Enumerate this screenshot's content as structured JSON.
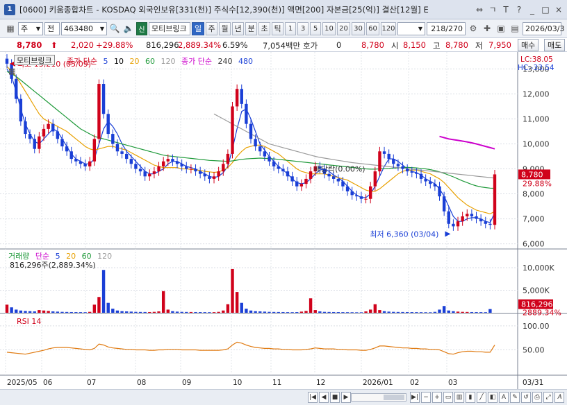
{
  "window": {
    "number": "1",
    "title": "[0600] 키움종합차트 - KOSDAQ 외국인보유[331(천)] 주식수[12,390(천)] 액면[200] 자본금[25(억)] 결산[12월] E",
    "controls": [
      "⇔",
      "ㄱ",
      "T",
      "?",
      "_",
      "□",
      "×"
    ]
  },
  "toolbar": {
    "market": "주",
    "type": "전",
    "code": "463480",
    "stock_name": "모티브링크",
    "period_tabs": [
      "일",
      "주",
      "월",
      "년",
      "분",
      "초",
      "틱"
    ],
    "active_period": "일",
    "intervals": [
      "1",
      "3",
      "5",
      "10",
      "20",
      "30",
      "60",
      "120"
    ],
    "count": "218",
    "count_total": "/270",
    "date": "2026/03/3",
    "sin_label": "신"
  },
  "price": {
    "current": "8,780",
    "change": "2,020",
    "change_pct": "+29.88%",
    "volume": "816,296",
    "volume_pct": "2,889.34%",
    "turnover": "6.59%",
    "amount": "7,054백만",
    "hoga_label": "호가",
    "hoga_value": "0",
    "hoga_price": "8,780",
    "open_label": "시",
    "open": "8,150",
    "high_label": "고",
    "high": "8,780",
    "low_label": "저",
    "low": "7,950",
    "buy_label": "매수",
    "sell_label": "매도"
  },
  "main_legend": {
    "badge": "모티브링크",
    "ma_label": "종가 단순",
    "ma_periods": [
      "5",
      "10",
      "20",
      "60",
      "120"
    ],
    "ma_colors": [
      "#1a3fd6",
      "#000000",
      "#e8a000",
      "#1f9a3a",
      "#9a9a9a"
    ],
    "ma2_label": "종가 단순",
    "ma2_periods": [
      "240",
      "480"
    ],
    "ma2_colors": [
      "#333333",
      "#cc00cc"
    ],
    "lc": "LC:38.05",
    "hc": "HC:-33.54"
  },
  "annotations": {
    "high": "최고 13,210 (05/09)",
    "low": "최저 6,360 (03/04)",
    "dividend": "배당락(0.00%)"
  },
  "volume_legend": {
    "label": "거래량",
    "ma_label": "단순",
    "periods": [
      "5",
      "20",
      "60",
      "120"
    ],
    "colors": [
      "#1a3fd6",
      "#e8a000",
      "#1f9a3a",
      "#9a9a9a"
    ],
    "value": "816,296주(2,889.34%)",
    "axis_marker": "816,296",
    "axis_marker2": "2889.34%"
  },
  "rsi_legend": {
    "label": "RSI 14"
  },
  "colors": {
    "up": "#d0021b",
    "down": "#1a3fd6",
    "rsi": "#e07a10"
  },
  "chart_data": [
    {
      "type": "candlestick",
      "title": "모티브링크",
      "x_labels": [
        "2025/05",
        "06",
        "07",
        "08",
        "09",
        "10",
        "11",
        "12",
        "2026/01",
        "02",
        "03",
        "03/31"
      ],
      "y_ticks": [
        6000,
        7000,
        8000,
        9000,
        10000,
        11000,
        12000,
        13000
      ],
      "ylim": [
        5850,
        13400
      ],
      "current_price": 8780,
      "current_pct": "29.88%",
      "series": [
        {
          "name": "close",
          "values": [
            13210,
            12600,
            11800,
            10900,
            10400,
            10200,
            9800,
            10300,
            10600,
            10800,
            10500,
            10200,
            9900,
            9700,
            9400,
            9300,
            9200,
            9100,
            9300,
            10200,
            12400,
            11200,
            10400,
            10000,
            9700,
            9600,
            9400,
            9200,
            9000,
            8900,
            8700,
            8800,
            8900,
            9100,
            9300,
            9400,
            9300,
            9200,
            9100,
            9000,
            9000,
            8900,
            8800,
            8700,
            8600,
            8700,
            8900,
            9200,
            9600,
            11500,
            12200,
            11600,
            10800,
            10200,
            9900,
            9700,
            9500,
            9300,
            9100,
            9000,
            8900,
            8700,
            8500,
            8300,
            8400,
            8600,
            8900,
            9100,
            9000,
            8800,
            8700,
            8600,
            8500,
            8300,
            8100,
            7950,
            7900,
            7800,
            7800,
            8300,
            8900,
            9700,
            9600,
            9400,
            9200,
            9100,
            9000,
            8900,
            8850,
            8800,
            8600,
            8500,
            8400,
            8300,
            7900,
            7300,
            6800,
            6700,
            6900,
            7100,
            7200,
            7100,
            7000,
            6900,
            6800,
            6760,
            8780
          ]
        },
        {
          "name": "ma5",
          "values": [
            13000,
            12700,
            12100,
            11400,
            10800,
            10400,
            10100,
            10000,
            10200,
            10400,
            10600,
            10500,
            10200,
            9900,
            9600,
            9400,
            9300,
            9200,
            9200,
            9400,
            10000,
            10600,
            10900,
            10700,
            10400,
            10000,
            9700,
            9500,
            9300,
            9100,
            8900,
            8800,
            8800,
            8900,
            9000,
            9200,
            9300,
            9300,
            9200,
            9100,
            9050,
            9000,
            8900,
            8800,
            8700,
            8650,
            8700,
            8850,
            9100,
            9800,
            10600,
            11300,
            11400,
            11000,
            10500,
            10000,
            9750,
            9500,
            9300,
            9100,
            8950,
            8800,
            8600,
            8450,
            8400,
            8450,
            8600,
            8800,
            8950,
            9000,
            8900,
            8750,
            8650,
            8500,
            8300,
            8100,
            7950,
            7850,
            7850,
            8000,
            8300,
            8700,
            9100,
            9400,
            9400,
            9300,
            9150,
            9000,
            8900,
            8850,
            8750,
            8600,
            8500,
            8400,
            8200,
            7900,
            7500,
            7100,
            6900,
            6900,
            7000,
            7050,
            7050,
            7000,
            6900,
            6850,
            7250
          ]
        },
        {
          "name": "ma20",
          "values": [
            13100,
            12900,
            12700,
            12400,
            12100,
            11800,
            11500,
            11200,
            11000,
            10900,
            10800,
            10700,
            10600,
            10500,
            10350,
            10200,
            10050,
            9900,
            9800,
            9750,
            9800,
            9850,
            9900,
            9900,
            9850,
            9800,
            9750,
            9650,
            9550,
            9450,
            9350,
            9250,
            9150,
            9100,
            9050,
            9050,
            9050,
            9050,
            9000,
            9000,
            8980,
            8960,
            8940,
            8900,
            8880,
            8860,
            8880,
            8950,
            9050,
            9250,
            9500,
            9700,
            9850,
            9900,
            9950,
            9950,
            9900,
            9800,
            9700,
            9600,
            9450,
            9300,
            9150,
            9000,
            8900,
            8850,
            8800,
            8800,
            8800,
            8800,
            8750,
            8700,
            8650,
            8600,
            8550,
            8450,
            8350,
            8250,
            8150,
            8100,
            8100,
            8200,
            8350,
            8500,
            8650,
            8800,
            8900,
            8950,
            8950,
            8950,
            8900,
            8850,
            8800,
            8700,
            8600,
            8450,
            8250,
            8050,
            7850,
            7700,
            7550,
            7450,
            7350,
            7300,
            7250,
            7200,
            7300
          ]
        },
        {
          "name": "ma60",
          "values": [
            12900,
            12800,
            12700,
            12550,
            12400,
            12250,
            12100,
            11950,
            11800,
            11650,
            11500,
            11350,
            11200,
            11050,
            10900,
            10750,
            10600,
            10500,
            10400,
            10300,
            10250,
            10200,
            10150,
            10100,
            10050,
            10000,
            9950,
            9900,
            9850,
            9800,
            9750,
            9700,
            9650,
            9600,
            9550,
            9520,
            9500,
            9480,
            9460,
            9440,
            9420,
            9400,
            9380,
            9360,
            9340,
            9330,
            9320,
            9310,
            9300,
            9320,
            9350,
            9380,
            9400,
            9410,
            9420,
            9430,
            9420,
            9410,
            9400,
            9380,
            9360,
            9340,
            9320,
            9300,
            9280,
            9260,
            9240,
            9220,
            9200,
            9180,
            9160,
            9140,
            9120,
            9100,
            9080,
            9060,
            9040,
            9020,
            9000,
            8990,
            8990,
            9000,
            9010,
            9020,
            9030,
            9040,
            9050,
            9060,
            9050,
            9040,
            9020,
            9000,
            8970,
            8930,
            8880,
            8820,
            8750,
            8680,
            8600,
            8520,
            8450,
            8380,
            8320,
            8280,
            8250,
            8230,
            8220
          ]
        },
        {
          "name": "ma120",
          "values": [
            null,
            null,
            null,
            null,
            null,
            null,
            null,
            null,
            null,
            null,
            null,
            null,
            null,
            null,
            null,
            null,
            null,
            null,
            null,
            null,
            null,
            null,
            null,
            null,
            null,
            null,
            null,
            null,
            null,
            null,
            null,
            null,
            null,
            null,
            null,
            null,
            null,
            null,
            null,
            null,
            null,
            null,
            null,
            null,
            null,
            11200,
            11100,
            11000,
            10900,
            10800,
            10700,
            10600,
            10500,
            10400,
            10300,
            10200,
            10100,
            10000,
            9950,
            9900,
            9850,
            9800,
            9750,
            9700,
            9650,
            9600,
            9550,
            9500,
            9460,
            9430,
            9400,
            9370,
            9340,
            9310,
            9280,
            9250,
            9230,
            9210,
            9190,
            9170,
            9150,
            9130,
            9110,
            9090,
            9070,
            9050,
            9030,
            9010,
            8990,
            8970,
            8950,
            8930,
            8910,
            8890,
            8870,
            8850,
            8830,
            8810,
            8790,
            8770,
            8750,
            8730,
            8710,
            8690,
            8670,
            8650,
            8630
          ]
        },
        {
          "name": "ma480",
          "values": [
            null,
            null,
            null,
            null,
            null,
            null,
            null,
            null,
            null,
            null,
            null,
            null,
            null,
            null,
            null,
            null,
            null,
            null,
            null,
            null,
            null,
            null,
            null,
            null,
            null,
            null,
            null,
            null,
            null,
            null,
            null,
            null,
            null,
            null,
            null,
            null,
            null,
            null,
            null,
            null,
            null,
            null,
            null,
            null,
            null,
            null,
            null,
            null,
            null,
            null,
            null,
            null,
            null,
            null,
            null,
            null,
            null,
            null,
            null,
            null,
            null,
            null,
            null,
            null,
            null,
            null,
            null,
            null,
            null,
            null,
            null,
            null,
            null,
            null,
            null,
            null,
            null,
            null,
            null,
            null,
            null,
            null,
            null,
            null,
            null,
            null,
            null,
            null,
            null,
            null,
            null,
            null,
            null,
            null,
            10300,
            10250,
            10200,
            10170,
            10140,
            10110,
            10080,
            10040,
            10000,
            9950,
            9900,
            9850,
            9800
          ]
        }
      ]
    },
    {
      "type": "bar",
      "title": "거래량",
      "y_ticks": [
        "5,000K",
        "10,000K"
      ],
      "ylim": [
        0,
        12000
      ],
      "series": [
        {
          "name": "volume",
          "values": [
            1800,
            1200,
            700,
            500,
            400,
            350,
            300,
            600,
            500,
            400,
            300,
            250,
            200,
            180,
            160,
            150,
            140,
            130,
            200,
            1800,
            3500,
            9500,
            2200,
            900,
            500,
            350,
            300,
            250,
            200,
            180,
            170,
            160,
            200,
            300,
            4800,
            700,
            350,
            250,
            200,
            180,
            170,
            160,
            150,
            140,
            130,
            140,
            200,
            500,
            1900,
            9700,
            4600,
            2200,
            900,
            500,
            350,
            300,
            250,
            200,
            180,
            170,
            160,
            140,
            130,
            150,
            250,
            400,
            3200,
            600,
            300,
            200,
            180,
            160,
            150,
            140,
            130,
            120,
            110,
            110,
            300,
            700,
            1900,
            600,
            350,
            250,
            200,
            180,
            170,
            160,
            150,
            140,
            130,
            120,
            110,
            200,
            700,
            1500,
            500,
            350,
            250,
            200,
            180,
            160,
            150,
            140,
            130,
            816
          ]
        }
      ]
    },
    {
      "type": "line",
      "title": "RSI 14",
      "y_ticks": [
        "50.00",
        "100.00"
      ],
      "ylim": [
        0,
        110
      ],
      "series": [
        {
          "name": "RSI 14",
          "values": [
            45,
            44,
            43,
            42,
            41,
            43,
            45,
            47,
            49,
            52,
            54,
            55,
            55,
            55,
            54,
            53,
            52,
            51,
            50,
            53,
            62,
            60,
            56,
            54,
            53,
            52,
            51,
            51,
            50,
            50,
            50,
            49,
            49,
            50,
            50,
            51,
            51,
            51,
            50,
            50,
            50,
            50,
            49,
            49,
            49,
            49,
            49,
            50,
            52,
            60,
            66,
            64,
            60,
            57,
            55,
            54,
            53,
            53,
            52,
            52,
            51,
            51,
            50,
            50,
            50,
            51,
            52,
            54,
            53,
            52,
            52,
            52,
            51,
            51,
            50,
            50,
            50,
            49,
            49,
            51,
            54,
            58,
            58,
            57,
            56,
            55,
            54,
            54,
            53,
            53,
            52,
            52,
            51,
            51,
            50,
            46,
            42,
            41,
            44,
            46,
            47,
            47,
            46,
            46,
            45,
            45,
            60
          ]
        }
      ]
    }
  ]
}
